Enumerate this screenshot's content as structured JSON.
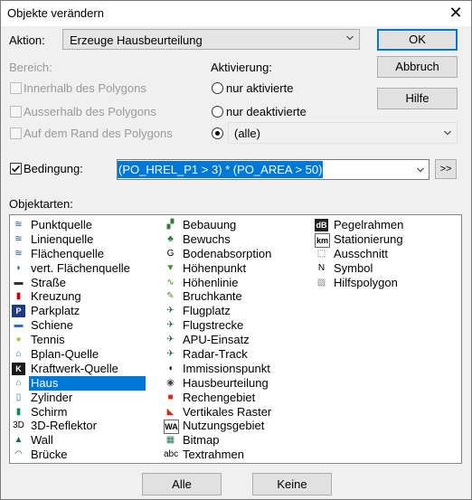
{
  "window": {
    "title": "Objekte verändern",
    "close_glyph": "✕"
  },
  "aktion": {
    "label": "Aktion:",
    "value": "Erzeuge Hausbeurteilung"
  },
  "bereich": {
    "label": "Bereich:",
    "options": [
      "Innerhalb des Polygons",
      "Ausserhalb des Polygons",
      "Auf dem Rand des Polygons"
    ]
  },
  "aktivierung": {
    "label": "Aktivierung:",
    "options": [
      "nur aktivierte",
      "nur deaktivierte"
    ],
    "select_value": "(alle)"
  },
  "buttons": {
    "ok": "OK",
    "cancel": "Abbruch",
    "help": "Hilfe",
    "all": "Alle",
    "none": "Keine",
    "more": ">>"
  },
  "bedingung": {
    "label": "Bedingung:",
    "value": "(PO_HREL_P1 > 3) * (PO_AREA > 50)"
  },
  "objektarten": {
    "label": "Objektarten:",
    "selected": "Haus",
    "col1": [
      {
        "icon": "point-source-icon",
        "label": "Punktquelle"
      },
      {
        "icon": "line-source-icon",
        "label": "Linienquelle"
      },
      {
        "icon": "area-source-icon",
        "label": "Flächenquelle"
      },
      {
        "icon": "vertical-area-source-icon",
        "label": "vert. Flächenquelle"
      },
      {
        "icon": "road-icon",
        "label": "Straße"
      },
      {
        "icon": "crossing-icon",
        "label": "Kreuzung"
      },
      {
        "icon": "parking-icon",
        "label": "Parkplatz"
      },
      {
        "icon": "rail-icon",
        "label": "Schiene"
      },
      {
        "icon": "tennis-icon",
        "label": "Tennis"
      },
      {
        "icon": "bplan-source-icon",
        "label": "Bplan-Quelle"
      },
      {
        "icon": "power-plant-source-icon",
        "label": "Kraftwerk-Quelle"
      },
      {
        "icon": "house-icon",
        "label": "Haus"
      },
      {
        "icon": "cylinder-icon",
        "label": "Zylinder"
      },
      {
        "icon": "screen-icon",
        "label": "Schirm"
      },
      {
        "icon": "3d-reflector-icon",
        "label": "3D-Reflektor"
      },
      {
        "icon": "wall-icon",
        "label": "Wall"
      },
      {
        "icon": "bridge-icon",
        "label": "Brücke"
      }
    ],
    "col2": [
      {
        "icon": "building-development-icon",
        "label": "Bebauung"
      },
      {
        "icon": "vegetation-icon",
        "label": "Bewuchs"
      },
      {
        "icon": "ground-absorption-icon",
        "label": "Bodenabsorption"
      },
      {
        "icon": "height-point-icon",
        "label": "Höhenpunkt"
      },
      {
        "icon": "contour-line-icon",
        "label": "Höhenlinie"
      },
      {
        "icon": "break-edge-icon",
        "label": "Bruchkante"
      },
      {
        "icon": "airfield-icon",
        "label": "Flugplatz"
      },
      {
        "icon": "flight-route-icon",
        "label": "Flugstrecke"
      },
      {
        "icon": "apu-icon",
        "label": "APU-Einsatz"
      },
      {
        "icon": "radar-track-icon",
        "label": "Radar-Track"
      },
      {
        "icon": "immission-point-icon",
        "label": "Immissionspunkt"
      },
      {
        "icon": "house-assessment-icon",
        "label": "Hausbeurteilung"
      },
      {
        "icon": "calculation-area-icon",
        "label": "Rechengebiet"
      },
      {
        "icon": "vertical-grid-icon",
        "label": "Vertikales Raster"
      },
      {
        "icon": "usage-area-icon",
        "label": "Nutzungsgebiet"
      },
      {
        "icon": "bitmap-icon",
        "label": "Bitmap"
      },
      {
        "icon": "text-frame-icon",
        "label": "Textrahmen"
      }
    ],
    "col3": [
      {
        "icon": "level-frame-icon",
        "label": "Pegelrahmen"
      },
      {
        "icon": "stationing-icon",
        "label": "Stationierung"
      },
      {
        "icon": "cutout-icon",
        "label": "Ausschnitt"
      },
      {
        "icon": "symbol-icon",
        "label": "Symbol"
      },
      {
        "icon": "auxiliary-polygon-icon",
        "label": "Hilfspolygon"
      }
    ]
  },
  "colors": {
    "accent": "#0078d7",
    "face": "#f0f0f0",
    "button": "#e1e1e1"
  }
}
